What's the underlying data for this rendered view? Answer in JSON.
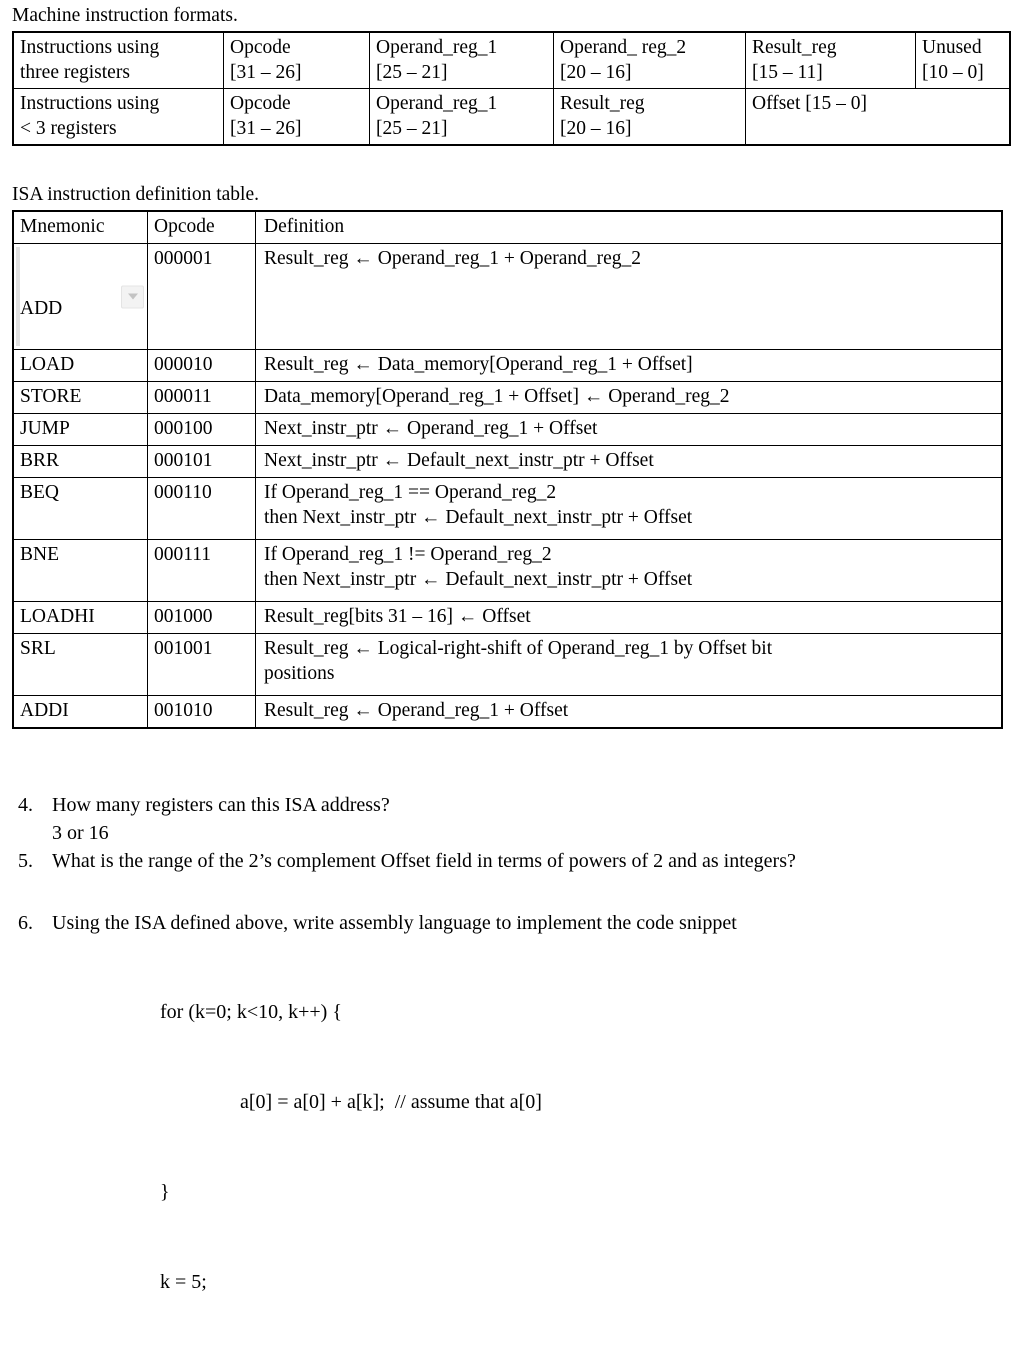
{
  "document": {
    "formats_caption": "Machine instruction formats.",
    "isa_caption": "ISA instruction definition table."
  },
  "formats_table": {
    "rows": [
      {
        "label": "Instructions using\nthree registers",
        "cells": [
          "Opcode\n[31 – 26]",
          "Operand_reg_1\n[25 – 21]",
          "Operand_ reg_2\n[20 – 16]",
          "Result_reg\n[15 – 11]",
          "Unused\n[10 – 0]"
        ]
      },
      {
        "label": "Instructions using\n< 3 registers",
        "cells": [
          "Opcode\n[31 – 26]",
          "Operand_reg_1\n[25 – 21]",
          "Result_reg\n[20 – 16]",
          "Offset [15 – 0]"
        ]
      }
    ]
  },
  "isa_table": {
    "headers": [
      "Mnemonic",
      "Opcode",
      "Definition"
    ],
    "rows": [
      {
        "mnemonic": "ADD",
        "opcode": "000001",
        "definition": "Result_reg ← Operand_reg_1 + Operand_reg_2",
        "has_dropdown": true,
        "dropdown_icon": "chevron-down-icon"
      },
      {
        "mnemonic": "LOAD",
        "opcode": "000010",
        "definition": "Result_reg ← Data_memory[Operand_reg_1 + Offset]",
        "has_dropdown": false
      },
      {
        "mnemonic": "STORE",
        "opcode": "000011",
        "definition": "Data_memory[Operand_reg_1 + Offset] ← Operand_reg_2",
        "has_dropdown": false
      },
      {
        "mnemonic": "JUMP",
        "opcode": "000100",
        "definition": "Next_instr_ptr ← Operand_reg_1 + Offset",
        "has_dropdown": false
      },
      {
        "mnemonic": "BRR",
        "opcode": "000101",
        "definition": "Next_instr_ptr ← Default_next_instr_ptr + Offset",
        "has_dropdown": false
      },
      {
        "mnemonic": "BEQ",
        "opcode": "000110",
        "definition": "If Operand_reg_1 == Operand_reg_2\nthen Next_instr_ptr ← Default_next_instr_ptr + Offset",
        "has_dropdown": false
      },
      {
        "mnemonic": "BNE",
        "opcode": "000111",
        "definition": "If Operand_reg_1 != Operand_reg_2\nthen Next_instr_ptr ← Default_next_instr_ptr + Offset",
        "has_dropdown": false
      },
      {
        "mnemonic": "LOADHI",
        "opcode": "001000",
        "definition": "Result_reg[bits 31 – 16] ← Offset",
        "has_dropdown": false
      },
      {
        "mnemonic": "SRL",
        "opcode": "001001",
        "definition": "Result_reg ← Logical-right-shift of Operand_reg_1 by Offset bit\npositions",
        "has_dropdown": false
      },
      {
        "mnemonic": "ADDI",
        "opcode": "001010",
        "definition": "Result_reg ← Operand_reg_1 + Offset",
        "has_dropdown": false
      }
    ]
  },
  "questions": [
    {
      "number": "4.",
      "text": "How many registers can this ISA address?",
      "answer": "3 or 16"
    },
    {
      "number": "5.",
      "text": "What is the range of the 2’s complement Offset field in terms of powers of 2 and as integers?"
    },
    {
      "number": "6.",
      "text": "Using the ISA defined above, write assembly language to implement the code snippet"
    }
  ],
  "code_snippet": {
    "line1": "for (k=0; k<10, k++) {",
    "line2": "a[0] = a[0] + a[k];  // assume that a[0]",
    "line3": "}",
    "line4": "k = 5;"
  }
}
